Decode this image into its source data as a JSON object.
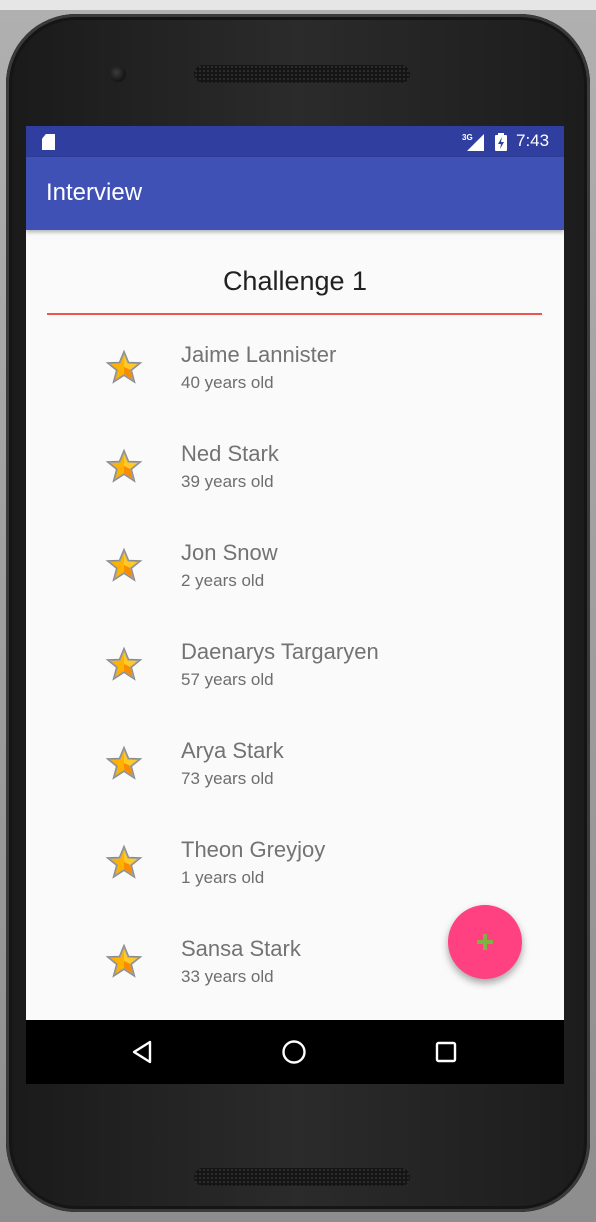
{
  "status_bar": {
    "time": "7:43",
    "network_label": "3G",
    "icons": [
      "sd-card-icon",
      "signal-icon",
      "battery-icon"
    ]
  },
  "app_bar": {
    "title": "Interview"
  },
  "challenge": {
    "title": "Challenge 1"
  },
  "people": [
    {
      "name": "Jaime Lannister",
      "age": "40 years old",
      "icon": "star-icon"
    },
    {
      "name": "Ned Stark",
      "age": "39 years old",
      "icon": "star-icon"
    },
    {
      "name": "Jon Snow",
      "age": "2 years old",
      "icon": "star-icon"
    },
    {
      "name": "Daenarys Targaryen",
      "age": "57 years old",
      "icon": "star-icon"
    },
    {
      "name": "Arya Stark",
      "age": "73 years old",
      "icon": "star-icon"
    },
    {
      "name": "Theon Greyjoy",
      "age": "1 years old",
      "icon": "star-icon"
    },
    {
      "name": "Sansa Stark",
      "age": "33 years old",
      "icon": "star-icon"
    }
  ],
  "fab": {
    "icon": "plus-icon"
  },
  "navigation": {
    "buttons": [
      "back-icon",
      "home-icon",
      "recent-apps-icon"
    ]
  },
  "colors": {
    "status_bar": "#303f9f",
    "app_bar": "#3f51b5",
    "accent": "#ff4081",
    "divider": "#ef5350",
    "background": "#fafafa"
  }
}
